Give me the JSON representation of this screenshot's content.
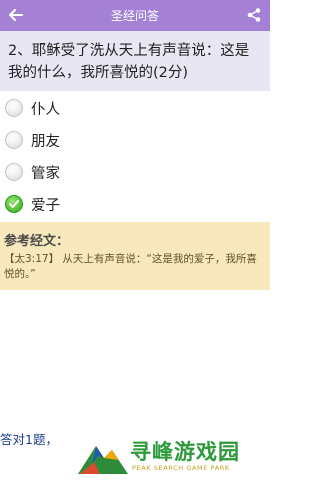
{
  "appbar": {
    "title": "圣经问答",
    "back_icon": "back-arrow-icon",
    "share_icon": "share-icon"
  },
  "question": {
    "text": "2、耶稣受了洗从天上有声音说：这是我的什么，我所喜悦的(2分)"
  },
  "options": [
    {
      "label": "仆人",
      "selected": false
    },
    {
      "label": "朋友",
      "selected": false
    },
    {
      "label": "管家",
      "selected": false
    },
    {
      "label": "爱子",
      "selected": true
    }
  ],
  "reference": {
    "title": "参考经文：",
    "text": "【太3:17】 从天上有声音说：“这是我的爱子，我所喜悦的。”"
  },
  "footer": {
    "status": "答对1题，"
  },
  "watermark": {
    "name": "寻峰游戏园",
    "subtitle": "PEAK SEARCH GAME PARK"
  },
  "colors": {
    "appbar": "#a581d6",
    "question_bg": "#e9e6f3",
    "reference_bg": "#f7e9bd",
    "selected": "#4fbf35"
  }
}
